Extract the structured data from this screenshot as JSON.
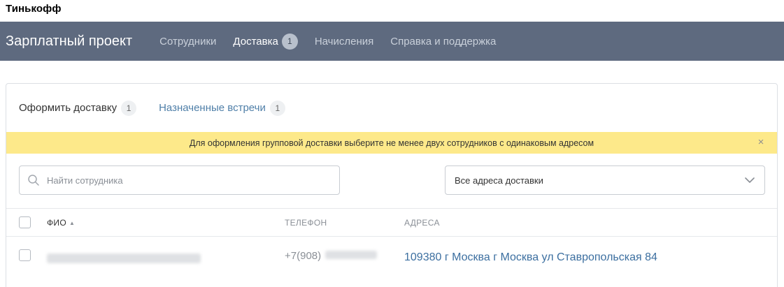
{
  "brand": "Тинькофф",
  "header": {
    "title": "Зарплатный проект",
    "nav": [
      {
        "label": "Сотрудники",
        "active": false
      },
      {
        "label": "Доставка",
        "active": true,
        "badge": "1"
      },
      {
        "label": "Начисления",
        "active": false
      },
      {
        "label": "Справка и поддержка",
        "active": false
      }
    ]
  },
  "tabs": [
    {
      "label": "Оформить доставку",
      "count": "1",
      "active": true
    },
    {
      "label": "Назначенные встречи",
      "count": "1",
      "active": false
    }
  ],
  "notice": {
    "text": "Для оформления групповой доставки выберите не менее двух сотрудников с одинаковым адресом",
    "close_icon": "×"
  },
  "search": {
    "placeholder": "Найти сотрудника",
    "value": ""
  },
  "address_filter": {
    "selected": "Все адреса доставки"
  },
  "table": {
    "columns": {
      "name": "ФИО",
      "name_sort_icon": "▲",
      "phone": "ТЕЛЕФОН",
      "address": "АДРЕСА"
    },
    "rows": [
      {
        "name": "",
        "phone_prefix": "+7(908)",
        "address": "109380 г Москва г Москва ул Ставропольская 84"
      }
    ]
  },
  "colors": {
    "header_bg": "#5e6a7f",
    "notice_bg": "#fde98a",
    "link": "#3c6fa0"
  }
}
